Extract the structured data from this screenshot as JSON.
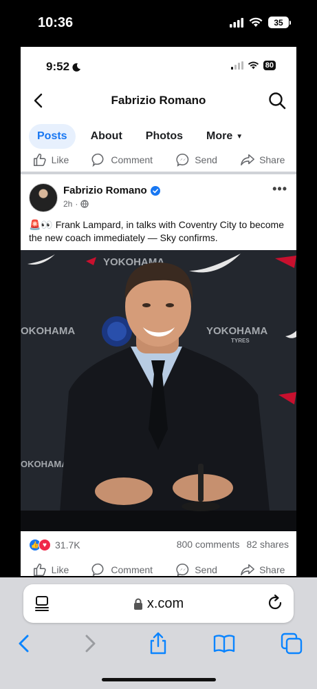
{
  "outer_status": {
    "time": "10:36",
    "battery": "35"
  },
  "inner_status": {
    "time": "9:52",
    "battery": "80"
  },
  "header": {
    "title": "Fabrizio Romano"
  },
  "tabs": [
    {
      "label": "Posts",
      "active": true
    },
    {
      "label": "About",
      "active": false
    },
    {
      "label": "Photos",
      "active": false
    },
    {
      "label": "More",
      "active": false
    }
  ],
  "actions": {
    "like": "Like",
    "comment": "Comment",
    "send": "Send",
    "share": "Share"
  },
  "post": {
    "author": "Fabrizio Romano",
    "time": "2h",
    "text": "🚨👀 Frank Lampard, in talks with Coventry City to become the new coach immediately — Sky confirms.",
    "photo_banner_1": "YOKOHAMA",
    "photo_banner_2": "YOKOHAMA",
    "photo_banner_3": "OKOHAMA",
    "photo_banner_4": "OKOHAMA",
    "photo_banner_tyres": "TYRES",
    "reactions": "31.7K",
    "comments": "800 comments",
    "shares": "82 shares"
  },
  "safari": {
    "url": "x.com"
  },
  "colors": {
    "accent": "#1877f2",
    "love": "#f02849",
    "toolbar_blue": "#0a84ff"
  }
}
